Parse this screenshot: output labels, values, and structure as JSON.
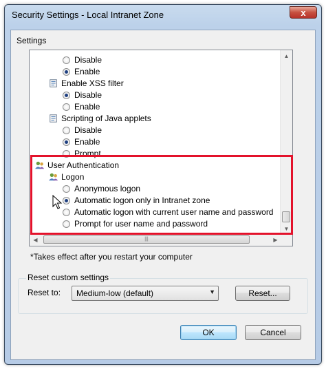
{
  "window": {
    "title": "Security Settings - Local Intranet Zone",
    "close_glyph": "x"
  },
  "settings_label": "Settings",
  "list": {
    "rows": [
      {
        "kind": "radio",
        "label": "Disable",
        "checked": false
      },
      {
        "kind": "radio",
        "label": "Enable",
        "checked": true
      },
      {
        "kind": "heading",
        "label": "Enable XSS filter",
        "icon": "script-setting-icon"
      },
      {
        "kind": "radio",
        "label": "Disable",
        "checked": true
      },
      {
        "kind": "radio",
        "label": "Enable",
        "checked": false
      },
      {
        "kind": "heading",
        "label": "Scripting of Java applets",
        "icon": "script-setting-icon"
      },
      {
        "kind": "radio",
        "label": "Disable",
        "checked": false
      },
      {
        "kind": "radio",
        "label": "Enable",
        "checked": true
      },
      {
        "kind": "radio",
        "label": "Prompt",
        "checked": false
      },
      {
        "kind": "category",
        "label": "User Authentication",
        "icon": "users-icon"
      },
      {
        "kind": "subheading",
        "label": "Logon",
        "icon": "users-icon"
      },
      {
        "kind": "radio",
        "label": "Anonymous logon",
        "checked": false
      },
      {
        "kind": "radio",
        "label": "Automatic logon only in Intranet zone",
        "checked": true
      },
      {
        "kind": "radio",
        "label": "Automatic logon with current user name and password",
        "checked": false
      },
      {
        "kind": "radio",
        "label": "Prompt for user name and password",
        "checked": false
      }
    ]
  },
  "note": "*Takes effect after you restart your computer",
  "reset_group": {
    "label": "Reset custom settings",
    "reset_to_label": "Reset to:",
    "selected_level": "Medium-low (default)",
    "reset_button": "Reset..."
  },
  "buttons": {
    "ok": "OK",
    "cancel": "Cancel"
  },
  "colors": {
    "highlight": "#e3122b",
    "radio_dot": "#1e3f80"
  }
}
